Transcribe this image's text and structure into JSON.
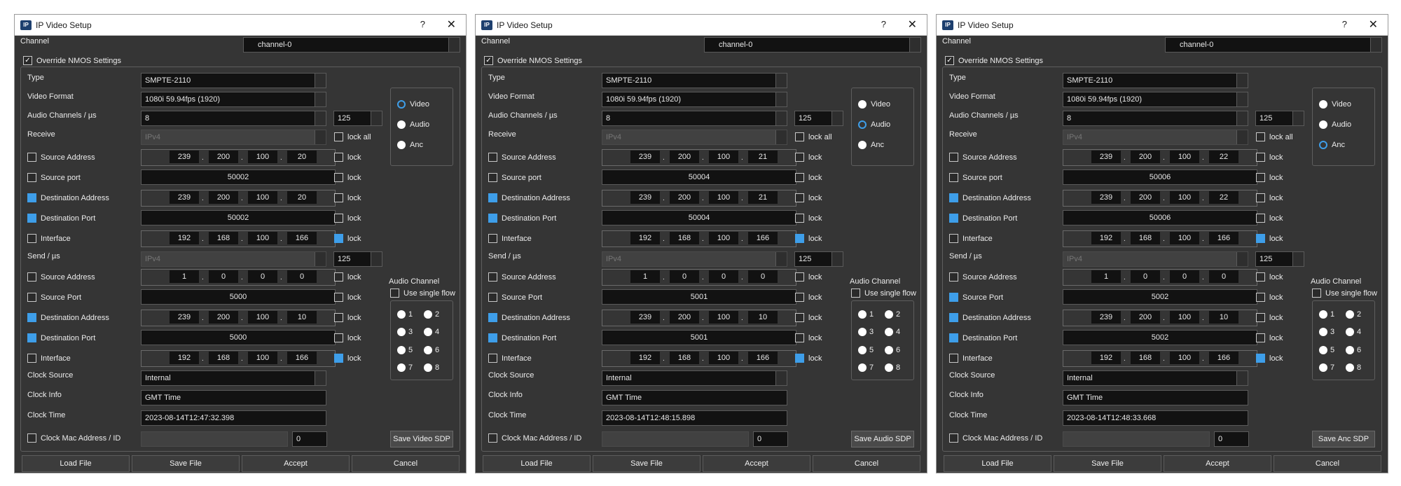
{
  "window": {
    "title": "IP Video Setup",
    "help": "?",
    "close": "✕"
  },
  "labels": {
    "channel": "Channel",
    "override": "Override NMOS Settings",
    "type": "Type",
    "video_format": "Video Format",
    "audio_channels": "Audio Channels / µs",
    "receive": "Receive",
    "send": "Send / µs",
    "source_address": "Source Address",
    "source_port_rx": "Source port",
    "source_port_tx": "Source Port",
    "destination_address": "Destination Address",
    "destination_port": "Destination Port",
    "interface": "Interface",
    "lock": "lock",
    "lock_all": "lock all",
    "clock_source": "Clock Source",
    "clock_info": "Clock Info",
    "clock_time": "Clock Time",
    "clock_mac": "Clock Mac Address / ID",
    "audio_channel_group": "Audio Channel",
    "use_single_flow": "Use single flow",
    "video": "Video",
    "audio": "Audio",
    "anc": "Anc"
  },
  "audio_flows": [
    "1",
    "2",
    "3",
    "4",
    "5",
    "6",
    "7",
    "8"
  ],
  "buttons": {
    "load": "Load File",
    "save": "Save File",
    "accept": "Accept",
    "cancel": "Cancel"
  },
  "dialogs": [
    {
      "channel": "channel-0",
      "type": "SMPTE-2110",
      "video_format": "1080i 59.94fps (1920)",
      "audio_channels": "8",
      "audio_us": "125",
      "receive_ip": "IPv4",
      "send_ip": "IPv4",
      "send_us": "125",
      "rx_src": [
        "239",
        "200",
        "100",
        "20"
      ],
      "rx_src_port": "50002",
      "rx_dst": [
        "239",
        "200",
        "100",
        "20"
      ],
      "rx_dst_port": "50002",
      "rx_if": [
        "192",
        "168",
        "100",
        "166"
      ],
      "tx_src": [
        "1",
        "0",
        "0",
        "0"
      ],
      "tx_src_port": "5000",
      "tx_dst": [
        "239",
        "200",
        "100",
        "10"
      ],
      "tx_dst_port": "5000",
      "tx_if": [
        "192",
        "168",
        "100",
        "166"
      ],
      "clock_source": "Internal",
      "clock_info": "GMT Time",
      "clock_time": "2023-08-14T12:47:32.398",
      "clock_mac": "",
      "clock_id": "0",
      "selected": "video",
      "tx_src_port_checked": false,
      "save_sdp": "Save Video SDP"
    },
    {
      "channel": "channel-0",
      "type": "SMPTE-2110",
      "video_format": "1080i 59.94fps (1920)",
      "audio_channels": "8",
      "audio_us": "125",
      "receive_ip": "IPv4",
      "send_ip": "IPv4",
      "send_us": "125",
      "rx_src": [
        "239",
        "200",
        "100",
        "21"
      ],
      "rx_src_port": "50004",
      "rx_dst": [
        "239",
        "200",
        "100",
        "21"
      ],
      "rx_dst_port": "50004",
      "rx_if": [
        "192",
        "168",
        "100",
        "166"
      ],
      "tx_src": [
        "1",
        "0",
        "0",
        "0"
      ],
      "tx_src_port": "5001",
      "tx_dst": [
        "239",
        "200",
        "100",
        "10"
      ],
      "tx_dst_port": "5001",
      "tx_if": [
        "192",
        "168",
        "100",
        "166"
      ],
      "clock_source": "Internal",
      "clock_info": "GMT Time",
      "clock_time": "2023-08-14T12:48:15.898",
      "clock_mac": "",
      "clock_id": "0",
      "selected": "audio",
      "tx_src_port_checked": false,
      "save_sdp": "Save Audio SDP"
    },
    {
      "channel": "channel-0",
      "type": "SMPTE-2110",
      "video_format": "1080i 59.94fps (1920)",
      "audio_channels": "8",
      "audio_us": "125",
      "receive_ip": "IPv4",
      "send_ip": "IPv4",
      "send_us": "125",
      "rx_src": [
        "239",
        "200",
        "100",
        "22"
      ],
      "rx_src_port": "50006",
      "rx_dst": [
        "239",
        "200",
        "100",
        "22"
      ],
      "rx_dst_port": "50006",
      "rx_if": [
        "192",
        "168",
        "100",
        "166"
      ],
      "tx_src": [
        "1",
        "0",
        "0",
        "0"
      ],
      "tx_src_port": "5002",
      "tx_dst": [
        "239",
        "200",
        "100",
        "10"
      ],
      "tx_dst_port": "5002",
      "tx_if": [
        "192",
        "168",
        "100",
        "166"
      ],
      "clock_source": "Internal",
      "clock_info": "GMT Time",
      "clock_time": "2023-08-14T12:48:33.668",
      "clock_mac": "",
      "clock_id": "0",
      "selected": "anc",
      "tx_src_port_checked": true,
      "save_sdp": "Save Anc SDP"
    }
  ]
}
